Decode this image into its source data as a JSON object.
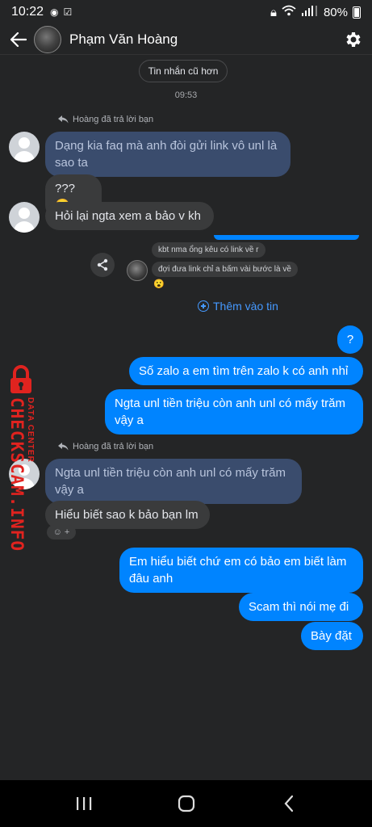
{
  "status_bar": {
    "time": "10:22",
    "battery": "80%"
  },
  "header": {
    "contact_name": "Phạm Văn Hoàng"
  },
  "older_messages_label": "Tin nhắn cũ hơn",
  "timestamp": "09:53",
  "messages": {
    "reply_note_1": "Hoàng đã trả lời bạn",
    "quoted_1": "Dạng kia faq mà anh đòi gửi link vô unl là sao ta",
    "recv_1": "???",
    "recv_1_emoji": "🙂",
    "recv_2": "Hỏi lại ngta xem a bảo v kh",
    "story_reply_1": "kbt nma ổng kêu có link về r",
    "story_reply_2": "đợi đưa link chỉ a bấm vài bước là về",
    "story_reaction": "😮",
    "add_to_story": "Thêm vào tin",
    "sent_1": "?",
    "sent_2": "Số zalo a em tìm trên zalo k có anh nhỉ",
    "sent_3": "Ngta unl tiền triệu còn anh unl có mấy trăm vậy a",
    "reply_note_2": "Hoàng đã trả lời bạn",
    "quoted_2": "Ngta unl tiền triệu còn anh unl có mấy trăm vậy a",
    "recv_3": "Hiểu biết sao k bảo bạn lm",
    "sent_4": "Em hiểu biết chứ em có bảo em biết làm đâu anh",
    "sent_5": "Scam thì nói mẹ đi",
    "sent_6": "Bày đặt"
  },
  "watermark": {
    "text": "CHECKSCAM.INFO",
    "sub": "DATA CENTER"
  },
  "colors": {
    "sent_bubble": "#0084ff",
    "received_bubble": "#3a3b3c",
    "quoted_bubble": "#3a4c6d",
    "link": "#4599ff"
  },
  "icons": [
    "back-arrow-icon",
    "gear-icon",
    "share-icon",
    "reply-arrow-icon",
    "plus-circle-icon",
    "recents-icon",
    "home-icon",
    "back-nav-icon",
    "lock-icon"
  ]
}
